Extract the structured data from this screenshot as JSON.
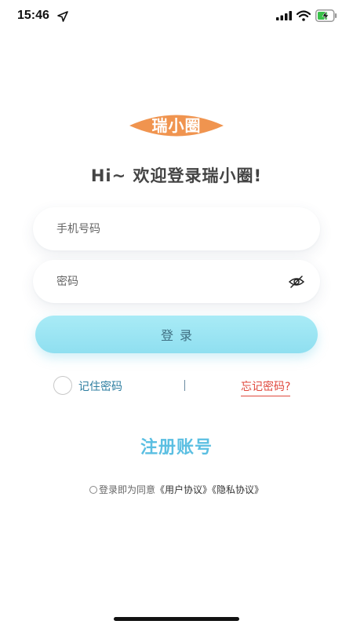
{
  "status_bar": {
    "time": "15:46",
    "icons": [
      "location-arrow-icon",
      "signal-bars-icon",
      "wifi-icon",
      "battery-charging-icon"
    ]
  },
  "logo": {
    "text": "瑞小圈",
    "color": "#f0944f"
  },
  "welcome_text": "Hi~ 欢迎登录瑞小圈!",
  "form": {
    "phone_placeholder": "手机号码",
    "password_placeholder": "密码",
    "password_toggle_icon": "eye-hidden-icon",
    "login_button": "登录"
  },
  "options": {
    "remember_label": "记住密码",
    "divider": "|",
    "forgot_label": "忘记密码?"
  },
  "register_label": "注册账号",
  "agreement": {
    "prefix": "登录即为同意",
    "user_agreement": "《用户协议》",
    "privacy_policy": "《隐私协议》"
  },
  "colors": {
    "accent_blue": "#5bbfe2",
    "login_button": "#a9ebf6",
    "forgot_red": "#e0483d",
    "logo_orange": "#f0944f"
  }
}
